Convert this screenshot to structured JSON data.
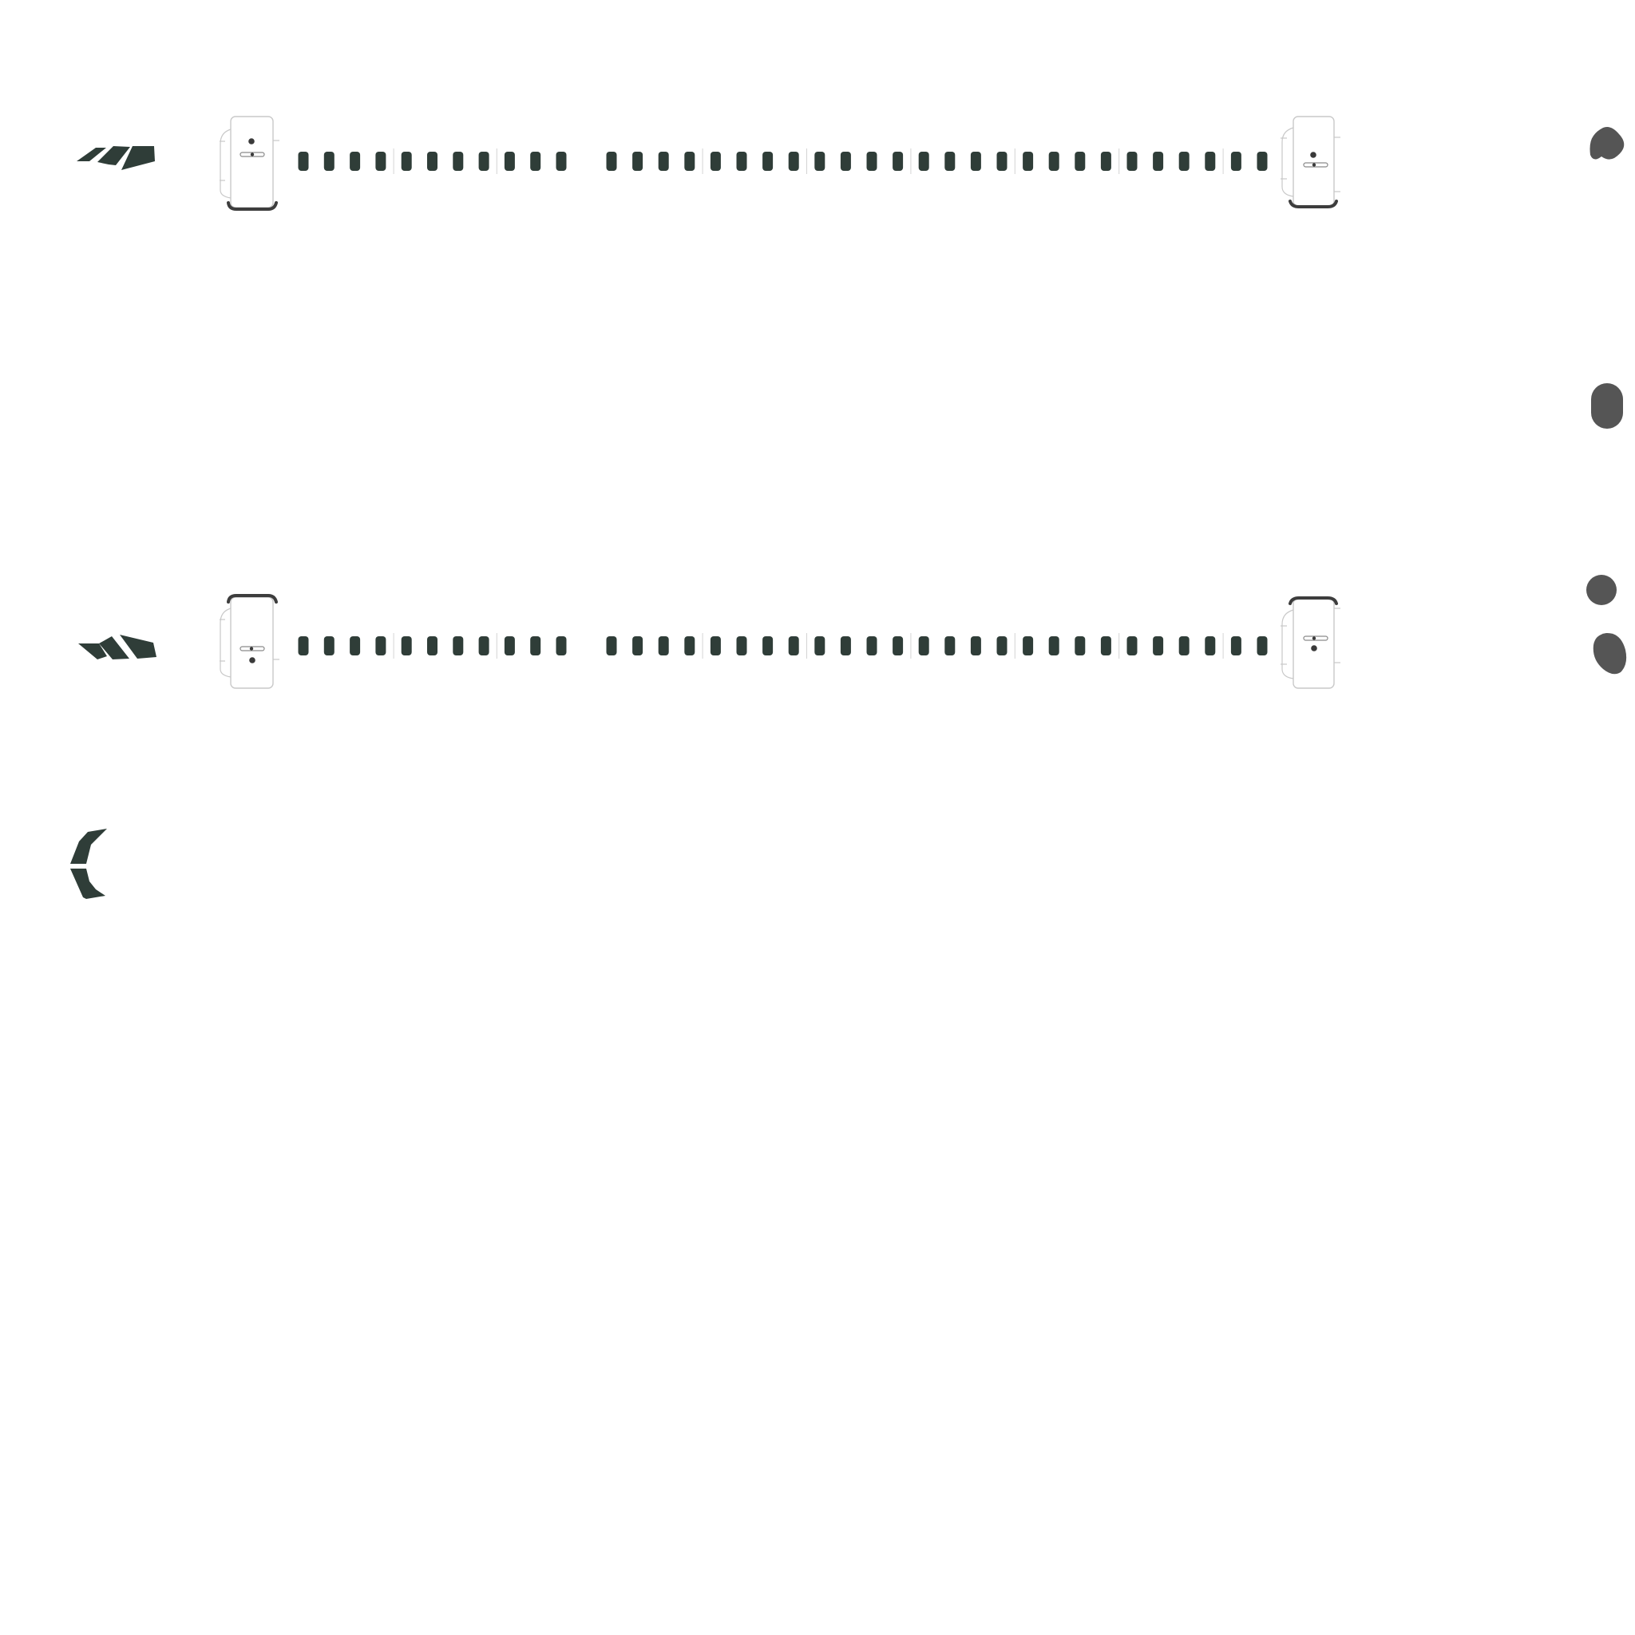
{
  "colors": {
    "background": "#ffffff",
    "segment": "#2f3d38",
    "blob": "#555555",
    "handle_border": "#c9c9c9",
    "handle_bar": "#3d3d3d"
  },
  "icons": {
    "row_logo": "tilted-parallelogram-cluster-icon",
    "row_logo_alt": "chevron-fan-icon",
    "bracket": "open-bracket-icon",
    "handle": "slider-handle-icon",
    "blob": "rounded-blob-icon"
  },
  "strips": [
    {
      "name": "strip-top",
      "left_segments": 11,
      "right_segments": 26
    },
    {
      "name": "strip-bottom",
      "left_segments": 11,
      "right_segments": 26
    }
  ]
}
